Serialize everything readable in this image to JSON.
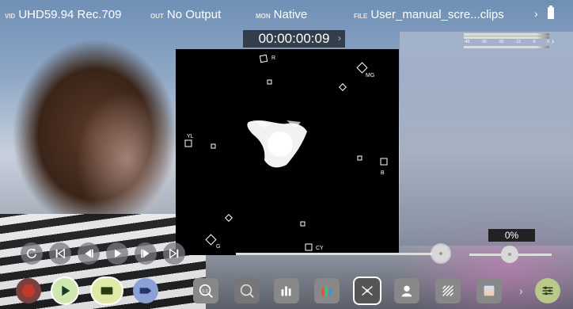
{
  "status": {
    "video_tag": "VID",
    "video_value": "UHD59.94 Rec.709",
    "output_tag": "OUT",
    "output_value": "No Output",
    "monitor_tag": "MON",
    "monitor_value": "Native",
    "file_tag": "FILE",
    "file_value": "User_manual_scre...clips"
  },
  "timecode": "00:00:00:09",
  "audio_meter": {
    "scale": [
      "-40",
      "-30",
      "-20",
      "-12",
      "-6",
      "0"
    ]
  },
  "vectorscope": {
    "targets": [
      "R",
      "MG",
      "YL",
      "B",
      "CY",
      "G"
    ]
  },
  "zoom_level": "0%",
  "playback_position": 0.98,
  "zoom_position": 0.5,
  "colors": {
    "record": "#c0392b",
    "play_accent": "#c8e6a0",
    "scope_bg": "#000000"
  },
  "icons": {
    "transport": [
      "loop-icon",
      "skip-start-icon",
      "step-back-icon",
      "play-icon",
      "step-forward-icon",
      "skip-end-icon"
    ],
    "toolbar": [
      "record-icon",
      "play-icon",
      "playlist-icon",
      "tag-icon",
      "zoom-1to1-icon",
      "zoom-2x-icon",
      "waveform-icon",
      "rgb-parade-icon",
      "vectorscope-icon",
      "skin-tone-icon",
      "zebra-icon",
      "false-color-icon",
      "settings-sliders-icon"
    ]
  }
}
